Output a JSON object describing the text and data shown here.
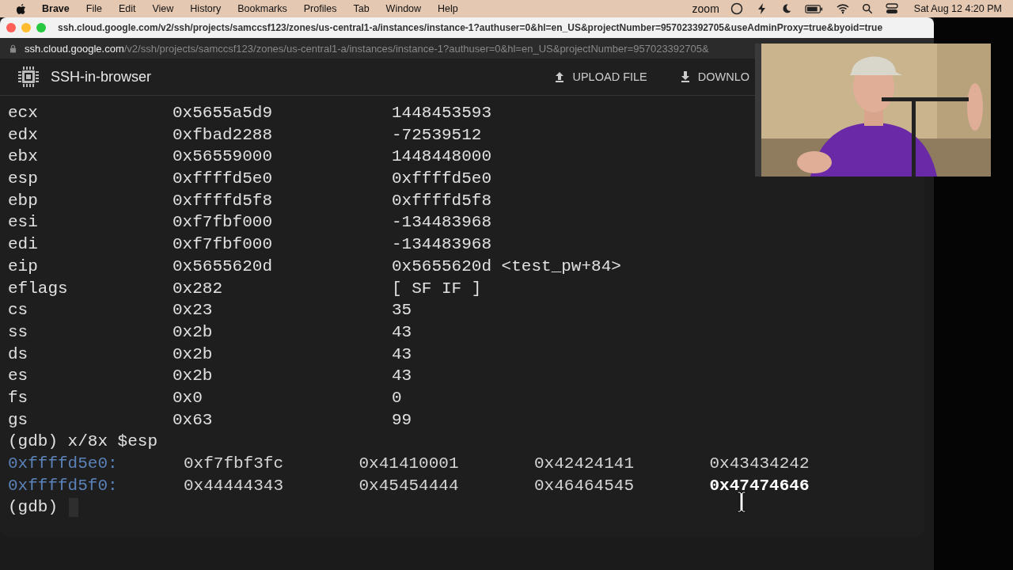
{
  "menubar": {
    "app": "Brave",
    "menus": [
      "File",
      "Edit",
      "View",
      "History",
      "Bookmarks",
      "Profiles",
      "Tab",
      "Window",
      "Help"
    ],
    "status_label": "zoom",
    "clock": "Sat Aug 12  4:20 PM"
  },
  "window": {
    "title": "ssh.cloud.google.com/v2/ssh/projects/samccsf123/zones/us-central1-a/instances/instance-1?authuser=0&hl=en_US&projectNumber=957023392705&useAdminProxy=true&byoid=true"
  },
  "address_bar": {
    "host": "ssh.cloud.google.com",
    "path": "/v2/ssh/projects/samccsf123/zones/us-central1-a/instances/instance-1?authuser=0&hl=en_US&projectNumber=957023392705&"
  },
  "header": {
    "title": "SSH-in-browser",
    "actions": [
      {
        "label": "UPLOAD FILE",
        "kind": "upload"
      },
      {
        "label": "DOWNLO",
        "kind": "download"
      }
    ]
  },
  "terminal": {
    "registers": [
      {
        "name": "ecx",
        "hex": "0x5655a5d9",
        "value": "1448453593"
      },
      {
        "name": "edx",
        "hex": "0xfbad2288",
        "value": "-72539512"
      },
      {
        "name": "ebx",
        "hex": "0x56559000",
        "value": "1448448000"
      },
      {
        "name": "esp",
        "hex": "0xffffd5e0",
        "value": "0xffffd5e0"
      },
      {
        "name": "ebp",
        "hex": "0xffffd5f8",
        "value": "0xffffd5f8"
      },
      {
        "name": "esi",
        "hex": "0xf7fbf000",
        "value": "-134483968"
      },
      {
        "name": "edi",
        "hex": "0xf7fbf000",
        "value": "-134483968"
      },
      {
        "name": "eip",
        "hex": "0x5655620d",
        "value": "0x5655620d <test_pw+84>"
      },
      {
        "name": "eflags",
        "hex": "0x282",
        "value": "[ SF IF ]"
      },
      {
        "name": "cs",
        "hex": "0x23",
        "value": "35"
      },
      {
        "name": "ss",
        "hex": "0x2b",
        "value": "43"
      },
      {
        "name": "ds",
        "hex": "0x2b",
        "value": "43"
      },
      {
        "name": "es",
        "hex": "0x2b",
        "value": "43"
      },
      {
        "name": "fs",
        "hex": "0x0",
        "value": "0"
      },
      {
        "name": "gs",
        "hex": "0x63",
        "value": "99"
      }
    ],
    "command": "(gdb) x/8x $esp",
    "memory": [
      {
        "address": "0xffffd5e0:",
        "words": [
          {
            "text": "0xf7fbf3fc",
            "highlighted": false
          },
          {
            "text": "0x41410001",
            "highlighted": false
          },
          {
            "text": "0x42424141",
            "highlighted": false
          },
          {
            "text": "0x43434242",
            "highlighted": false
          }
        ]
      },
      {
        "address": "0xffffd5f0:",
        "words": [
          {
            "text": "0x44444343",
            "highlighted": false
          },
          {
            "text": "0x45454444",
            "highlighted": false
          },
          {
            "text": "0x46464545",
            "highlighted": false
          },
          {
            "text": "0x47474646",
            "highlighted": true
          }
        ]
      }
    ],
    "prompt": "(gdb)"
  }
}
